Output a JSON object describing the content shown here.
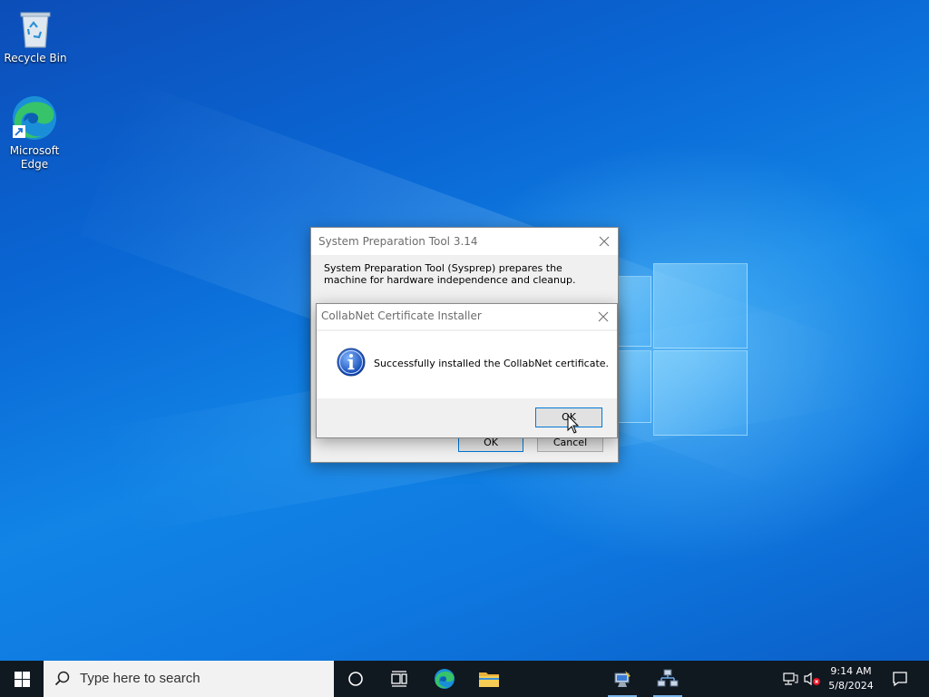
{
  "desktop": {
    "icons": [
      {
        "label": "Recycle Bin",
        "icon": "recycle-bin-icon"
      },
      {
        "label": "Microsoft Edge",
        "icon": "edge-icon"
      }
    ]
  },
  "sysprep_dialog": {
    "title": "System Preparation Tool 3.14",
    "description": "System Preparation Tool (Sysprep) prepares the machine for hardware independence and cleanup.",
    "ok_label": "OK",
    "cancel_label": "Cancel"
  },
  "collabnet_dialog": {
    "title": "CollabNet Certificate Installer",
    "message": "Successfully installed the CollabNet certificate.",
    "ok_label": "OK",
    "icon": "information-icon"
  },
  "taskbar": {
    "search_placeholder": "Type here to search",
    "pinned": [
      "search-circle-icon",
      "task-view-icon",
      "edge-icon",
      "file-explorer-icon",
      "sysprep-app-icon",
      "network-app-icon"
    ],
    "tray": {
      "time": "9:14 AM",
      "date": "5/8/2024",
      "icons": [
        "network-icon",
        "volume-muted-icon",
        "notifications-icon"
      ]
    }
  },
  "colors": {
    "taskbar_bg": "#101820",
    "dialog_bg": "#f0f0f0",
    "default_button_border": "#0078d7",
    "accent": "#0078d7"
  }
}
